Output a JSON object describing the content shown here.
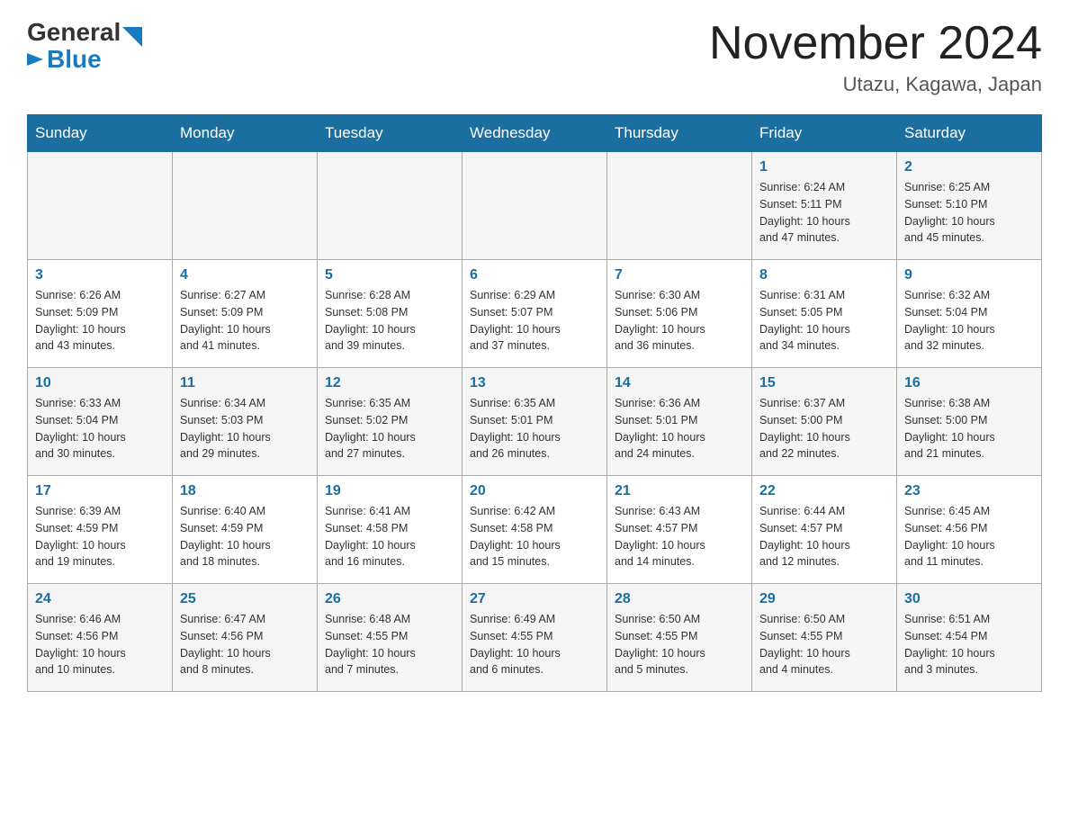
{
  "header": {
    "logo_general": "General",
    "logo_blue": "Blue",
    "month_title": "November 2024",
    "location": "Utazu, Kagawa, Japan"
  },
  "weekdays": [
    "Sunday",
    "Monday",
    "Tuesday",
    "Wednesday",
    "Thursday",
    "Friday",
    "Saturday"
  ],
  "weeks": [
    {
      "days": [
        {
          "number": "",
          "info": ""
        },
        {
          "number": "",
          "info": ""
        },
        {
          "number": "",
          "info": ""
        },
        {
          "number": "",
          "info": ""
        },
        {
          "number": "",
          "info": ""
        },
        {
          "number": "1",
          "info": "Sunrise: 6:24 AM\nSunset: 5:11 PM\nDaylight: 10 hours\nand 47 minutes."
        },
        {
          "number": "2",
          "info": "Sunrise: 6:25 AM\nSunset: 5:10 PM\nDaylight: 10 hours\nand 45 minutes."
        }
      ]
    },
    {
      "days": [
        {
          "number": "3",
          "info": "Sunrise: 6:26 AM\nSunset: 5:09 PM\nDaylight: 10 hours\nand 43 minutes."
        },
        {
          "number": "4",
          "info": "Sunrise: 6:27 AM\nSunset: 5:09 PM\nDaylight: 10 hours\nand 41 minutes."
        },
        {
          "number": "5",
          "info": "Sunrise: 6:28 AM\nSunset: 5:08 PM\nDaylight: 10 hours\nand 39 minutes."
        },
        {
          "number": "6",
          "info": "Sunrise: 6:29 AM\nSunset: 5:07 PM\nDaylight: 10 hours\nand 37 minutes."
        },
        {
          "number": "7",
          "info": "Sunrise: 6:30 AM\nSunset: 5:06 PM\nDaylight: 10 hours\nand 36 minutes."
        },
        {
          "number": "8",
          "info": "Sunrise: 6:31 AM\nSunset: 5:05 PM\nDaylight: 10 hours\nand 34 minutes."
        },
        {
          "number": "9",
          "info": "Sunrise: 6:32 AM\nSunset: 5:04 PM\nDaylight: 10 hours\nand 32 minutes."
        }
      ]
    },
    {
      "days": [
        {
          "number": "10",
          "info": "Sunrise: 6:33 AM\nSunset: 5:04 PM\nDaylight: 10 hours\nand 30 minutes."
        },
        {
          "number": "11",
          "info": "Sunrise: 6:34 AM\nSunset: 5:03 PM\nDaylight: 10 hours\nand 29 minutes."
        },
        {
          "number": "12",
          "info": "Sunrise: 6:35 AM\nSunset: 5:02 PM\nDaylight: 10 hours\nand 27 minutes."
        },
        {
          "number": "13",
          "info": "Sunrise: 6:35 AM\nSunset: 5:01 PM\nDaylight: 10 hours\nand 26 minutes."
        },
        {
          "number": "14",
          "info": "Sunrise: 6:36 AM\nSunset: 5:01 PM\nDaylight: 10 hours\nand 24 minutes."
        },
        {
          "number": "15",
          "info": "Sunrise: 6:37 AM\nSunset: 5:00 PM\nDaylight: 10 hours\nand 22 minutes."
        },
        {
          "number": "16",
          "info": "Sunrise: 6:38 AM\nSunset: 5:00 PM\nDaylight: 10 hours\nand 21 minutes."
        }
      ]
    },
    {
      "days": [
        {
          "number": "17",
          "info": "Sunrise: 6:39 AM\nSunset: 4:59 PM\nDaylight: 10 hours\nand 19 minutes."
        },
        {
          "number": "18",
          "info": "Sunrise: 6:40 AM\nSunset: 4:59 PM\nDaylight: 10 hours\nand 18 minutes."
        },
        {
          "number": "19",
          "info": "Sunrise: 6:41 AM\nSunset: 4:58 PM\nDaylight: 10 hours\nand 16 minutes."
        },
        {
          "number": "20",
          "info": "Sunrise: 6:42 AM\nSunset: 4:58 PM\nDaylight: 10 hours\nand 15 minutes."
        },
        {
          "number": "21",
          "info": "Sunrise: 6:43 AM\nSunset: 4:57 PM\nDaylight: 10 hours\nand 14 minutes."
        },
        {
          "number": "22",
          "info": "Sunrise: 6:44 AM\nSunset: 4:57 PM\nDaylight: 10 hours\nand 12 minutes."
        },
        {
          "number": "23",
          "info": "Sunrise: 6:45 AM\nSunset: 4:56 PM\nDaylight: 10 hours\nand 11 minutes."
        }
      ]
    },
    {
      "days": [
        {
          "number": "24",
          "info": "Sunrise: 6:46 AM\nSunset: 4:56 PM\nDaylight: 10 hours\nand 10 minutes."
        },
        {
          "number": "25",
          "info": "Sunrise: 6:47 AM\nSunset: 4:56 PM\nDaylight: 10 hours\nand 8 minutes."
        },
        {
          "number": "26",
          "info": "Sunrise: 6:48 AM\nSunset: 4:55 PM\nDaylight: 10 hours\nand 7 minutes."
        },
        {
          "number": "27",
          "info": "Sunrise: 6:49 AM\nSunset: 4:55 PM\nDaylight: 10 hours\nand 6 minutes."
        },
        {
          "number": "28",
          "info": "Sunrise: 6:50 AM\nSunset: 4:55 PM\nDaylight: 10 hours\nand 5 minutes."
        },
        {
          "number": "29",
          "info": "Sunrise: 6:50 AM\nSunset: 4:55 PM\nDaylight: 10 hours\nand 4 minutes."
        },
        {
          "number": "30",
          "info": "Sunrise: 6:51 AM\nSunset: 4:54 PM\nDaylight: 10 hours\nand 3 minutes."
        }
      ]
    }
  ]
}
